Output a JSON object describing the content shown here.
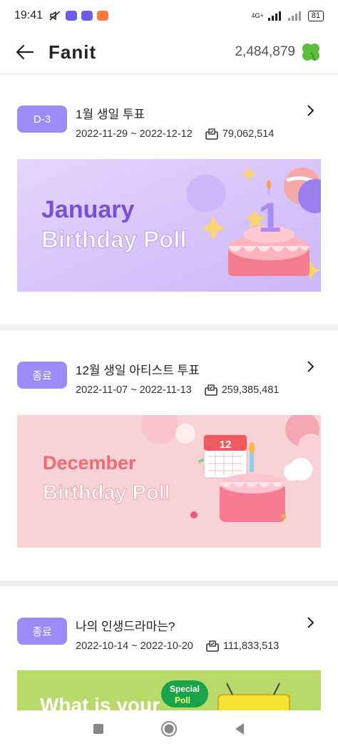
{
  "status_bar": {
    "time": "19:41",
    "network": "4G+",
    "battery": "81"
  },
  "app_bar": {
    "title": "Fanit",
    "points": "2,484,879"
  },
  "polls": [
    {
      "badge": "D-3",
      "title": "1월 생일 투표",
      "period": "2022-11-29 ~ 2022-12-12",
      "votes": "79,062,514",
      "banner_line1": "January",
      "banner_line2": "Birthday Poll",
      "banner_number": "1"
    },
    {
      "badge": "종료",
      "title": "12월 생일 아티스트 투표",
      "period": "2022-11-07 ~ 2022-11-13",
      "votes": "259,385,481",
      "banner_line1": "December",
      "banner_line2": "Birthday Poll",
      "banner_number": "12"
    },
    {
      "badge": "종료",
      "title": "나의 인생드라마는?",
      "period": "2022-10-14 ~ 2022-10-20",
      "votes": "111,833,513",
      "banner_line1": "What is your",
      "banner_tag1": "Special",
      "banner_tag2": "Poll"
    }
  ],
  "colors": {
    "badge": "#9b8cf7",
    "clover": "#5cbf3a",
    "jan_bg": "#d9c8fb",
    "dec_bg": "#f8d3d6",
    "drama_bg": "#b9d96a"
  }
}
